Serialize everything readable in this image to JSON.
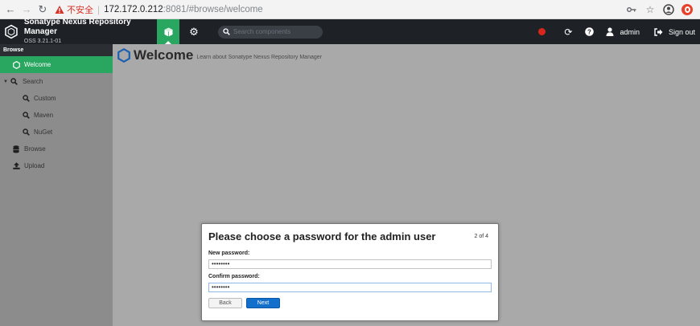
{
  "browser": {
    "insecure_label": "不安全",
    "url_host": "172.172.0.212",
    "url_rest": ":8081/#browse/welcome",
    "icons": [
      "back-arrow-icon",
      "forward-arrow-icon",
      "reload-icon",
      "key-icon",
      "star-icon",
      "account-icon",
      "opera-icon"
    ]
  },
  "header": {
    "title": "Sonatype Nexus Repository Manager",
    "version": "OSS 3.21.1-01",
    "search_placeholder": "Search components",
    "user": "admin",
    "signout": "Sign out"
  },
  "sidebar": {
    "heading": "Browse",
    "items": [
      {
        "label": "Welcome",
        "icon": "hexagon-icon",
        "active": true
      },
      {
        "label": "Search",
        "icon": "search-icon"
      },
      {
        "label": "Custom",
        "icon": "search-icon"
      },
      {
        "label": "Maven",
        "icon": "search-icon"
      },
      {
        "label": "NuGet",
        "icon": "search-icon"
      },
      {
        "label": "Browse",
        "icon": "database-icon"
      },
      {
        "label": "Upload",
        "icon": "upload-icon"
      }
    ]
  },
  "main": {
    "title": "Welcome",
    "subtitle": "Learn about Sonatype Nexus Repository Manager"
  },
  "dialog": {
    "title": "Please choose a password for the admin user",
    "step": "2 of 4",
    "new_password_label": "New password:",
    "new_password_value": "••••••••",
    "confirm_password_label": "Confirm password:",
    "confirm_password_value": "••••••••",
    "back_label": "Back",
    "next_label": "Next"
  },
  "colors": {
    "accent_green": "#29a660",
    "header_bg": "#1e2227",
    "primary_blue": "#136fcc",
    "alert_red": "#d9261c"
  }
}
